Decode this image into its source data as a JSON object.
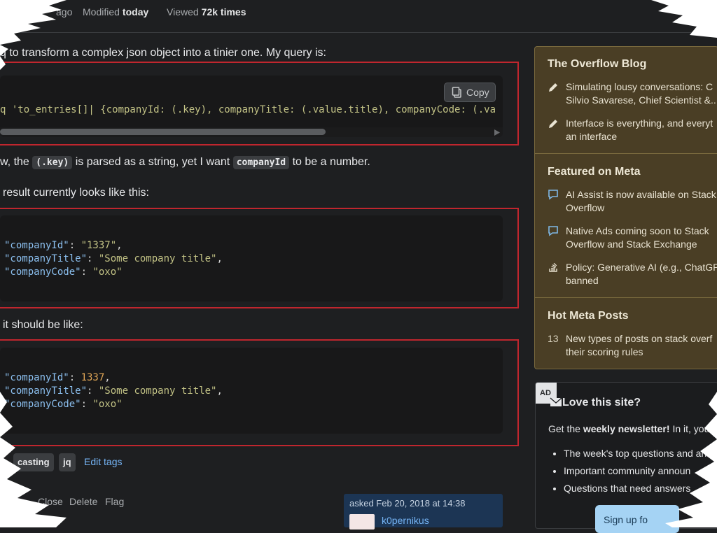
{
  "meta": {
    "asked_fragment": "ago",
    "modified_label": "Modified",
    "modified_value": "today",
    "viewed_label": "Viewed",
    "viewed_value": "72k times"
  },
  "question": {
    "intro": "q to transform a complex json object into a tinier one. My query is:",
    "query_code": "q 'to_entries[]| {companyId: (.key), companyTitle: (.value.title), companyCode: (.va",
    "copy_label": "Copy",
    "line_key_pre": "w, the",
    "line_key_code1": "(.key)",
    "line_key_mid": "is parsed as a string, yet I want",
    "line_key_code2": "companyId",
    "line_key_post": "to be a number.",
    "result_intro": "result currently looks like this:",
    "current": {
      "k1": "\"companyId\"",
      "v1": "\"1337\"",
      "k2": "\"companyTitle\"",
      "v2": "\"Some company title\"",
      "k3": "\"companyCode\"",
      "v3": "\"oxo\""
    },
    "should_intro": "it should be like:",
    "expected": {
      "k1": "\"companyId\"",
      "v1": "1337",
      "k2": "\"companyTitle\"",
      "v2": "\"Some company title\"",
      "k3": "\"companyCode\"",
      "v3": "\"oxo\""
    },
    "tags": [
      "casting",
      "jq"
    ],
    "edit_tags": "Edit tags",
    "actions": [
      "Close",
      "Delete",
      "Flag"
    ],
    "asked_line": "asked Feb 20, 2018 at 14:38",
    "user_name": "k0pernikus"
  },
  "sidebar": {
    "blog_title": "The Overflow Blog",
    "blog_items": [
      [
        "Simulating lousy conversations: C",
        "Silvio Savarese, Chief Scientist &..."
      ],
      [
        "Interface is everything, and everyt",
        "an interface"
      ]
    ],
    "meta_title": "Featured on Meta",
    "meta_items": [
      [
        "AI Assist is now available on Stack",
        "Overflow"
      ],
      [
        "Native Ads coming soon to Stack",
        "Overflow and Stack Exchange"
      ],
      [
        "Policy: Generative AI (e.g., ChatGP",
        "banned"
      ]
    ],
    "hot_title": "Hot Meta Posts",
    "hot_count": "13",
    "hot_item": [
      "New types of posts on stack overf",
      "their scoring rules"
    ]
  },
  "ad": {
    "badge": "AD",
    "title": "Love this site?",
    "line_pre": "Get the",
    "line_bold": "weekly newsletter!",
    "line_post": "In it, you",
    "bullets": [
      "The week's top questions and an",
      "Important community announ",
      "Questions that need answers"
    ],
    "signup": "Sign up fo"
  },
  "colors": {
    "page_bg": "#1e1f21",
    "highlight_red": "#c0262e",
    "sidebar_bg": "#4a3e25",
    "link": "#75b4f5",
    "number": "#e3a857"
  }
}
